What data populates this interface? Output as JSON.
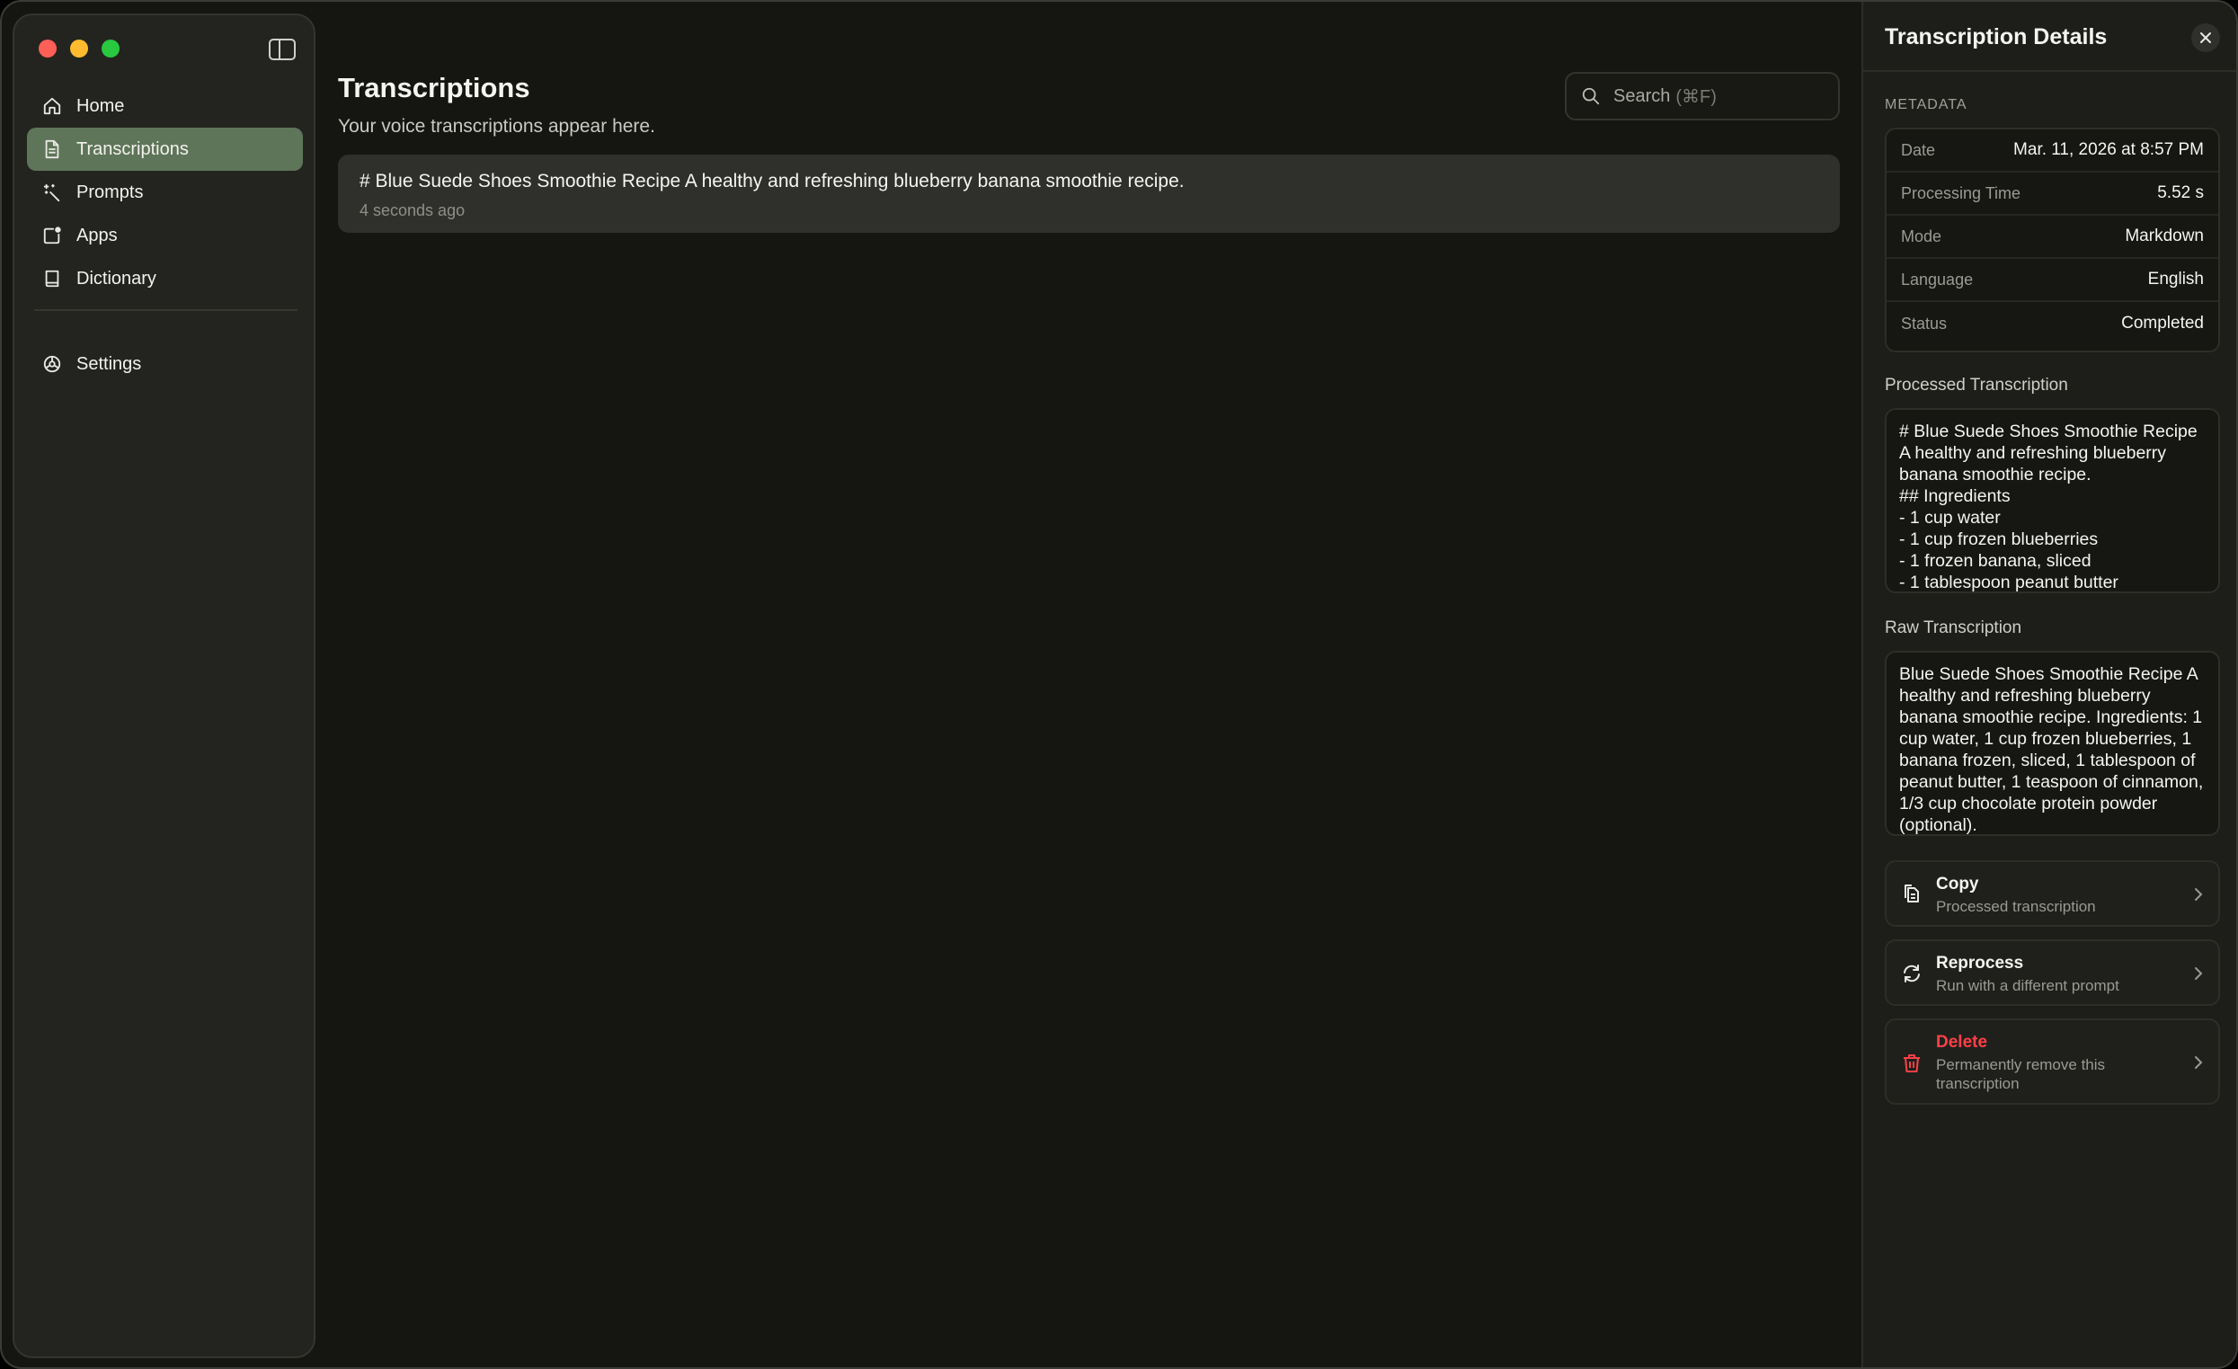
{
  "sidebar": {
    "items": [
      {
        "label": "Home",
        "icon": "home-icon"
      },
      {
        "label": "Transcriptions",
        "icon": "document-icon",
        "active": true
      },
      {
        "label": "Prompts",
        "icon": "magic-wand-icon"
      },
      {
        "label": "Apps",
        "icon": "apps-icon"
      },
      {
        "label": "Dictionary",
        "icon": "book-icon"
      }
    ],
    "settings": {
      "label": "Settings",
      "icon": "gear-icon"
    },
    "accent_color": "#5f7559"
  },
  "main": {
    "title": "Transcriptions",
    "subtitle": "Your voice transcriptions appear here.",
    "search": {
      "placeholder": "Search",
      "shortcut": "(⌘F)"
    },
    "transcriptions": [
      {
        "text": "# Blue Suede Shoes Smoothie Recipe A healthy and refreshing blueberry banana smoothie recipe.",
        "time": "4 seconds ago"
      }
    ]
  },
  "panel": {
    "title": "Transcription Details",
    "metadata_label": "METADATA",
    "metadata": [
      {
        "key": "Date",
        "value": "Mar. 11, 2026 at 8:57 PM"
      },
      {
        "key": "Processing Time",
        "value": "5.52 s"
      },
      {
        "key": "Mode",
        "value": "Markdown"
      },
      {
        "key": "Language",
        "value": "English"
      },
      {
        "key": "Status",
        "value": "Completed"
      }
    ],
    "processed_label": "Processed Transcription",
    "processed_text": "# Blue Suede Shoes Smoothie Recipe\nA healthy and refreshing blueberry banana smoothie recipe.\n## Ingredients\n- 1 cup water\n- 1 cup frozen blueberries\n- 1 frozen banana, sliced\n- 1 tablespoon peanut butter",
    "raw_label": "Raw Transcription",
    "raw_text": "Blue Suede Shoes Smoothie Recipe A healthy and refreshing blueberry banana smoothie recipe. Ingredients: 1 cup water, 1 cup frozen blueberries, 1 banana frozen, sliced, 1 tablespoon of peanut butter, 1 teaspoon of cinnamon, 1/3 cup chocolate protein powder (optional).",
    "actions": [
      {
        "title": "Copy",
        "subtitle": "Processed transcription",
        "icon": "copy-icon"
      },
      {
        "title": "Reprocess",
        "subtitle": "Run with a different prompt",
        "icon": "refresh-icon"
      },
      {
        "title": "Delete",
        "subtitle": "Permanently remove this transcription",
        "icon": "trash-icon",
        "color": "#ff4048"
      }
    ]
  }
}
